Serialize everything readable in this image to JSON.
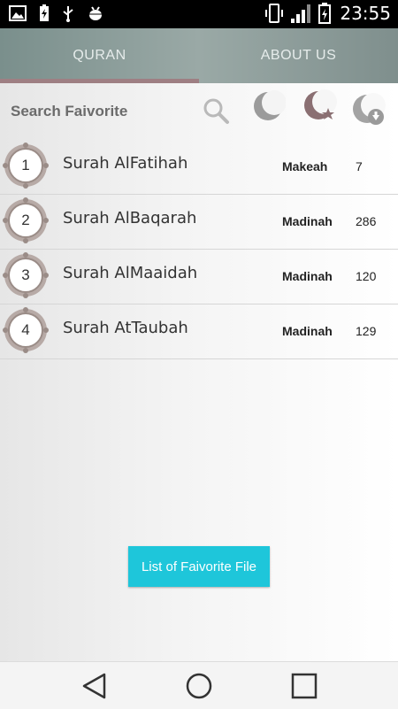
{
  "status_bar": {
    "time": "23:55",
    "left_icons": [
      "image-icon",
      "battery-charging-icon",
      "usb-icon",
      "android-debug-icon"
    ],
    "right_icons": [
      "phone-vibrate-icon",
      "signal-icon",
      "battery-icon"
    ]
  },
  "tabs": [
    {
      "label": "QURAN",
      "selected": true
    },
    {
      "label": "ABOUT US",
      "selected": false
    }
  ],
  "toolbar": {
    "search_label": "Search Faivorite",
    "icons": [
      "search-icon",
      "crescent-moon-icon",
      "crescent-star-icon",
      "crescent-download-icon"
    ]
  },
  "surahs": [
    {
      "number": "1",
      "name": "Surah AlFatihah",
      "place": "Makeah",
      "verses": "7"
    },
    {
      "number": "2",
      "name": "Surah AlBaqarah",
      "place": "Madinah",
      "verses": "286"
    },
    {
      "number": "3",
      "name": "Surah AlMaaidah",
      "place": "Madinah",
      "verses": "120"
    },
    {
      "number": "4",
      "name": "Surah AtTaubah",
      "place": "Madinah",
      "verses": "129"
    }
  ],
  "fav_button_label": "List of Faivorite File",
  "navbar": [
    "back-icon",
    "home-icon",
    "recents-icon"
  ],
  "colors": {
    "accent": "#1ec6da",
    "tab_bar": "#8fa09d",
    "tab_indicator": "#9e7f83"
  }
}
